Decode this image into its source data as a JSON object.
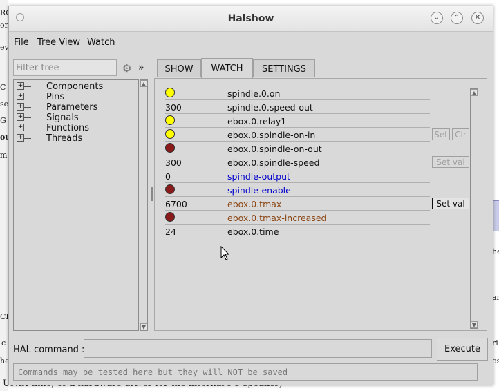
{
  "window": {
    "title": "Halshow"
  },
  "titlebar_buttons": [
    "chevron-down-icon",
    "chevron-up-icon",
    "close-icon"
  ],
  "menu": [
    "File",
    "Tree View",
    "Watch"
  ],
  "filter": {
    "placeholder": "Filter tree"
  },
  "tree": {
    "items": [
      "Components",
      "Pins",
      "Parameters",
      "Signals",
      "Functions",
      "Threads"
    ]
  },
  "tabs": [
    {
      "label": "SHOW",
      "active": false
    },
    {
      "label": "WATCH",
      "active": true
    },
    {
      "label": "SETTINGS",
      "active": false
    }
  ],
  "colors": {
    "led_on": "#ffff00",
    "led_off": "#8b1a1a",
    "signal_text": "#0000cc",
    "param_text": "#8b4513",
    "pin_text": "#111111"
  },
  "watch": {
    "rows": [
      {
        "value": "",
        "led": "on",
        "name": "spindle.0.on",
        "kind": "pin"
      },
      {
        "value": "300",
        "led": null,
        "name": "spindle.0.speed-out",
        "kind": "pin"
      },
      {
        "value": "",
        "led": "on",
        "name": "ebox.0.relay1",
        "kind": "pin"
      },
      {
        "value": "",
        "led": "on",
        "name": "ebox.0.spindle-on-in",
        "kind": "pin",
        "buttons": [
          "Set",
          "Clr"
        ],
        "buttons_enabled": false
      },
      {
        "value": "",
        "led": "off",
        "name": "ebox.0.spindle-on-out",
        "kind": "pin"
      },
      {
        "value": "300",
        "led": null,
        "name": "ebox.0.spindle-speed",
        "kind": "pin",
        "buttons": [
          "Set val"
        ],
        "buttons_enabled": false
      },
      {
        "value": "0",
        "led": null,
        "name": "spindle-output",
        "kind": "signal"
      },
      {
        "value": "",
        "led": "off",
        "name": "spindle-enable",
        "kind": "signal"
      },
      {
        "value": "6700",
        "led": null,
        "name": "ebox.0.tmax",
        "kind": "param",
        "buttons": [
          "Set val"
        ],
        "buttons_enabled": true
      },
      {
        "value": "",
        "led": "off",
        "name": "ebox.0.tmax-increased",
        "kind": "param"
      },
      {
        "value": "24",
        "led": null,
        "name": "ebox.0.time",
        "kind": "pin"
      }
    ]
  },
  "hal": {
    "label": "HAL command :",
    "value": "",
    "execute_label": "Execute"
  },
  "status": {
    "text": "Commands may be tested here but they will NOT be saved"
  },
  "background_fragments": [
    "RC",
    "on",
    "ev",
    "C",
    "se",
    "G",
    "ou",
    "m",
    "CL",
    "he",
    "an",
    "ri",
    "os",
    "c",
    "he"
  ],
  "background_bottom_text": "UNIX time, or a hardware driver for the internal PC speaker)"
}
